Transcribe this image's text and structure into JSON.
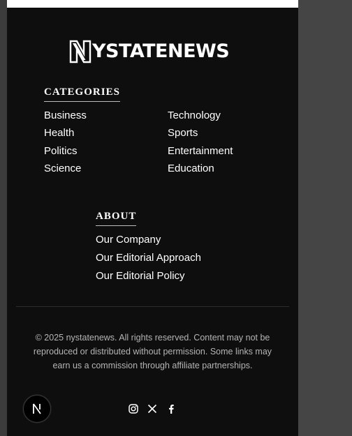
{
  "brand": {
    "logo_text": "NYSTATENEWS"
  },
  "categories": {
    "title": "CATEGORIES",
    "items": [
      "Business",
      "Technology",
      "Health",
      "Sports",
      "Politics",
      "Entertainment",
      "Science",
      "Education"
    ]
  },
  "about": {
    "title": "ABOUT",
    "items": [
      "Our Company",
      "Our Editorial Approach",
      "Our Editorial Policy"
    ]
  },
  "footer": {
    "copyright": "© 2025 nystatenews. All rights reserved. Content may not be reproduced or distributed without permission. Some links may earn us a commission through affiliate partnerships."
  },
  "social": {
    "icons": [
      "instagram-icon",
      "x-icon",
      "facebook-icon"
    ]
  },
  "colors": {
    "background": "#0e0e0e",
    "text": "#ffffff",
    "muted": "#b5b5b5",
    "outer": "#454545"
  }
}
